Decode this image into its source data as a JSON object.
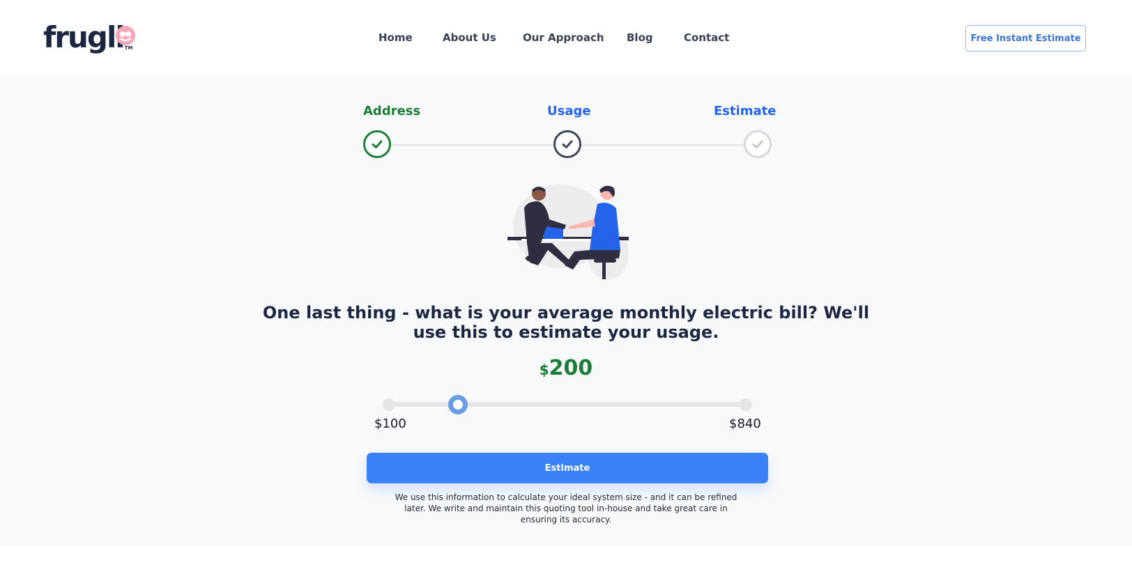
{
  "header": {
    "logo": {
      "text": "frugll",
      "tm": "TM"
    },
    "nav": [
      "Home",
      "About Us",
      "Our Approach",
      "Blog",
      "Contact"
    ],
    "cta_label": "Free Instant Estimate"
  },
  "steps": [
    {
      "label": "Address",
      "state": "complete",
      "color": "#1c7c3a"
    },
    {
      "label": "Usage",
      "state": "current",
      "color": "#2563eb"
    },
    {
      "label": "Estimate",
      "state": "pending",
      "color": "#2563eb"
    }
  ],
  "question": "One last thing - what is your average monthly electric bill? We'll use this to estimate your usage.",
  "amount": {
    "currency": "$",
    "value": "200"
  },
  "slider": {
    "min_label": "$100",
    "max_label": "$840",
    "min": 100,
    "max": 840,
    "value": 200
  },
  "estimate_button": "Estimate",
  "disclaimer": "We use this information to calculate your ideal system size - and it can be refined later. We write and maintain this quoting tool in-house and take great care in ensuring its accuracy.",
  "colors": {
    "accent": "#3b82f6",
    "green": "#1c7c3a",
    "logo_pink": "#f4a7b9"
  }
}
